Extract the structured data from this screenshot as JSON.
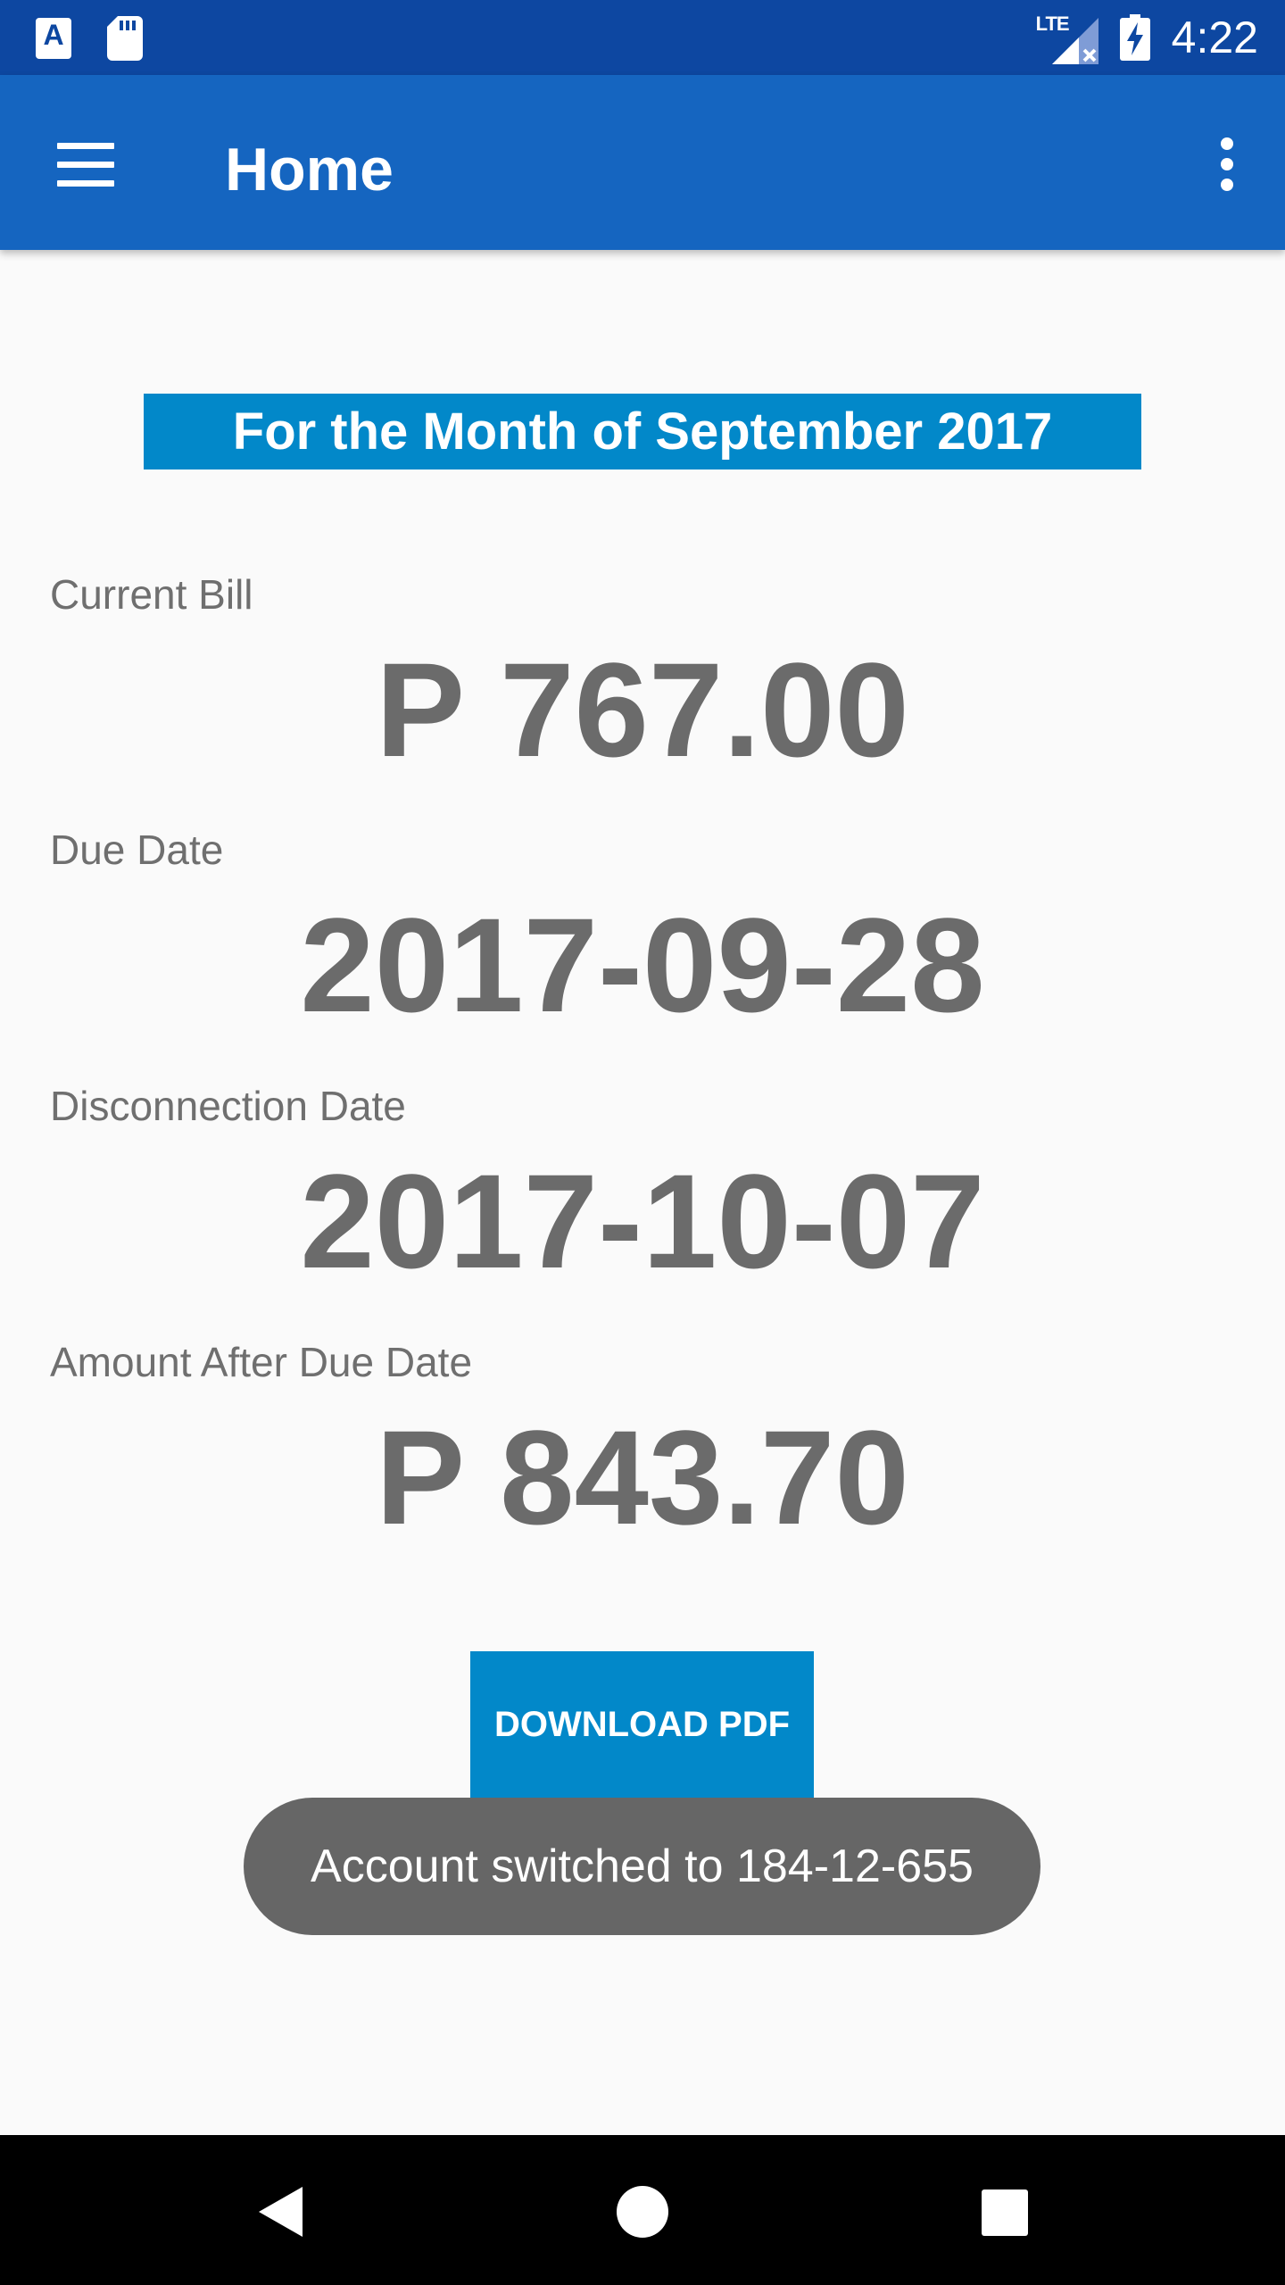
{
  "status_bar": {
    "time": "4:22",
    "network_label": "LTE",
    "icons": [
      "accessibility-a-icon",
      "sd-card-icon",
      "lte-signal-icon",
      "battery-charging-icon"
    ]
  },
  "app_bar": {
    "title": "Home",
    "menu_icon": "hamburger-menu-icon",
    "overflow_icon": "more-vert-icon"
  },
  "bill": {
    "banner": "For the Month of September 2017",
    "current_bill_label": "Current Bill",
    "current_bill_value": "P 767.00",
    "due_date_label": "Due Date",
    "due_date_value": "2017-09-28",
    "disconnection_date_label": "Disconnection Date",
    "disconnection_date_value": "2017-10-07",
    "amount_after_due_label": "Amount After Due Date",
    "amount_after_due_value": "P 843.70"
  },
  "actions": {
    "download_label": "DOWNLOAD PDF"
  },
  "toast": {
    "message": "Account switched to 184-12-655"
  },
  "nav_bar": {
    "icons": [
      "back-icon",
      "home-icon",
      "recents-icon"
    ]
  },
  "colors": {
    "status_bar": "#0d47a1",
    "app_bar": "#1565c0",
    "accent": "#0288c9",
    "value_text": "#6b6b6b",
    "toast_bg": "#666666"
  }
}
